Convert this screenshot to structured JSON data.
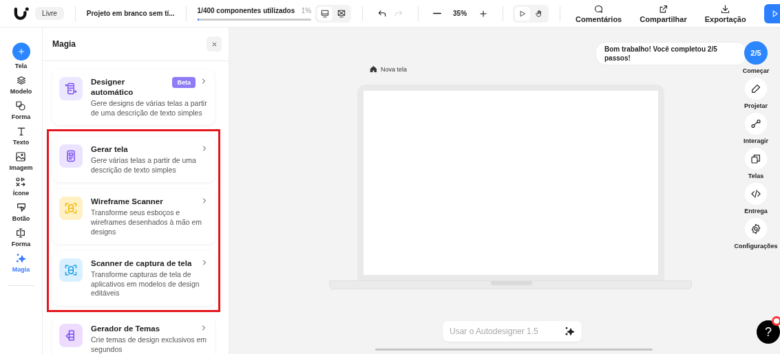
{
  "topbar": {
    "plan": "Livre",
    "project_title": "Projeto em branco sem tí...",
    "usage": {
      "label": "1/400 componentes utilizados",
      "percent": "1%",
      "level": 0.01
    },
    "view_toggle": [
      {
        "selected": true
      },
      {
        "selected": false
      }
    ],
    "history": [
      {
        "disabled": false
      },
      {
        "disabled": true
      }
    ],
    "zoom": "35%",
    "tool_toggle": [
      {
        "selected": true
      },
      {
        "selected": false
      }
    ],
    "actions": [
      {
        "label": "Comentários"
      },
      {
        "label": "Compartilhar"
      },
      {
        "label": "Exportação"
      }
    ]
  },
  "rail": [
    {
      "label": "Tela",
      "kind": "add",
      "selected": false
    },
    {
      "label": "Modelo",
      "kind": "tool",
      "selected": false
    },
    {
      "label": "Forma",
      "kind": "tool",
      "selected": false
    },
    {
      "label": "Texto",
      "kind": "tool",
      "selected": false
    },
    {
      "label": "Imagem",
      "kind": "tool",
      "selected": false
    },
    {
      "label": "Ícone",
      "kind": "tool",
      "selected": false
    },
    {
      "label": "Botão",
      "kind": "tool",
      "selected": false
    },
    {
      "label": "Forma",
      "kind": "tool",
      "selected": false
    },
    {
      "label": "Magia",
      "kind": "tool",
      "selected": true
    }
  ],
  "panel": {
    "title": "Magia",
    "cards": [
      {
        "title": "Designer automático",
        "badge": "Beta",
        "description": "Gere designs de várias telas a partir de uma descrição de texto simples",
        "color": "#ebe7ff",
        "highlighted": false
      },
      {
        "title": "Gerar tela",
        "description": "Gere várias telas a partir de uma descrição de texto simples",
        "color": "#ece3ff",
        "highlighted": true
      },
      {
        "title": "Wireframe Scanner",
        "description": "Transforme seus esboços e wireframes desenhados à mão em designs",
        "color": "#fff1c4",
        "highlighted": true
      },
      {
        "title": "Scanner de captura de tela",
        "description": "Transforme capturas de tela de aplicativos em modelos de design editáveis",
        "color": "#d8f0ff",
        "highlighted": true
      },
      {
        "title": "Gerador de Temas",
        "description": "Crie temas de design exclusivos em segundos",
        "color": "#eedcff",
        "highlighted": false
      }
    ]
  },
  "canvas": {
    "screen_label": "Nova tela",
    "toast": "Bom trabalho! Você completou 2/5 passos!",
    "progress_badge": "2/5",
    "side_actions": [
      {
        "label": "Começar"
      },
      {
        "label": "Projetar"
      },
      {
        "label": "Interagir"
      },
      {
        "label": "Telas"
      },
      {
        "label": "Entrega"
      },
      {
        "label": "Configurações"
      }
    ],
    "prompt": {
      "placeholder": "Usar o Autodesigner 1.5"
    },
    "help": {
      "label": "?",
      "notification": true
    }
  }
}
